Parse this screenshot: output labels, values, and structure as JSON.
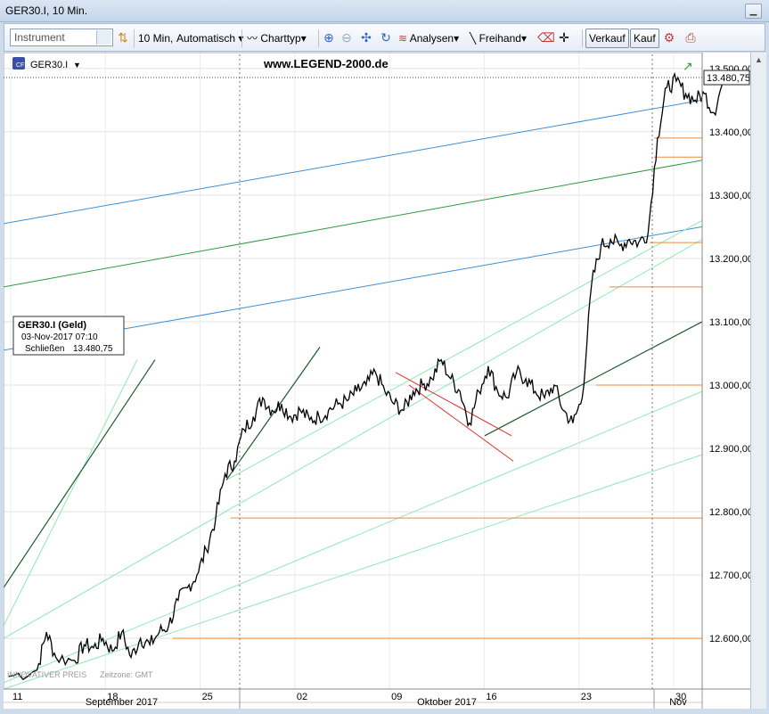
{
  "window": {
    "title": "GER30.I, 10 Min."
  },
  "toolbar": {
    "instrument_placeholder": "Instrument",
    "interval_label": "10 Min,",
    "scale_label": "Automatisch",
    "charttype_label": "Charttyp",
    "analysen_label": "Analysen",
    "freihand_label": "Freihand",
    "sell_label": "Verkauf",
    "buy_label": "Kauf"
  },
  "chart": {
    "symbol_label": "GER30.I",
    "watermark": "www.LEGEND-2000.de",
    "current_price_label": "13.480,75",
    "footer_left": "INNOVATIVER PREIS",
    "footer_tz": "Zeitzone: GMT",
    "infobox": {
      "title": "GER30.I (Geld)",
      "datetime": "03-Nov-2017 07:10",
      "close_label": "Schließen",
      "close_value": "13.480,75"
    },
    "colors": {
      "price": "#000000",
      "blue_line": "#3d8fd0",
      "green_line": "#2e9a3e",
      "light_green": "#8fe8b2",
      "dark_green": "#1d5a2e",
      "red_line": "#e03030",
      "orange_line": "#ef8a3a"
    }
  },
  "chart_data": {
    "type": "line",
    "series_name": "GER30.I",
    "y_ticks": [
      "13.500,00",
      "13.400,00",
      "13.300,00",
      "13.200,00",
      "13.100,00",
      "13.000,00",
      "12.900,00",
      "12.800,00",
      "12.700,00",
      "12.600,00"
    ],
    "y_tick_values": [
      13500,
      13400,
      13300,
      13200,
      13100,
      13000,
      12900,
      12800,
      12700,
      12600
    ],
    "ylim": [
      12520,
      13525
    ],
    "x_day_labels": [
      "11",
      "18",
      "25",
      "02",
      "09",
      "16",
      "23",
      "30"
    ],
    "x_month_labels": [
      "September 2017",
      "Oktober 2017",
      "Nov"
    ],
    "last_value": 13480.75,
    "price_path": [
      [
        0,
        12540
      ],
      [
        3,
        12550
      ],
      [
        4,
        12610
      ],
      [
        5,
        12570
      ],
      [
        7,
        12565
      ],
      [
        8,
        12590
      ],
      [
        9,
        12585
      ],
      [
        10,
        12600
      ],
      [
        11,
        12580
      ],
      [
        12,
        12610
      ],
      [
        13,
        12570
      ],
      [
        14,
        12600
      ],
      [
        15,
        12590
      ],
      [
        16,
        12610
      ],
      [
        17,
        12620
      ],
      [
        18,
        12660
      ],
      [
        19,
        12680
      ],
      [
        20,
        12700
      ],
      [
        21,
        12740
      ],
      [
        22,
        12790
      ],
      [
        23,
        12860
      ],
      [
        24,
        12880
      ],
      [
        25,
        12930
      ],
      [
        26,
        12950
      ],
      [
        27,
        12980
      ],
      [
        28,
        12960
      ],
      [
        29,
        12970
      ],
      [
        30,
        12950
      ],
      [
        31,
        12960
      ],
      [
        32,
        12945
      ],
      [
        33,
        12950
      ],
      [
        34,
        12960
      ],
      [
        35,
        12970
      ],
      [
        36,
        12975
      ],
      [
        37,
        12990
      ],
      [
        38,
        13000
      ],
      [
        39,
        13020
      ],
      [
        40,
        12990
      ],
      [
        41,
        12970
      ],
      [
        42,
        12960
      ],
      [
        43,
        12990
      ],
      [
        44,
        13000
      ],
      [
        45,
        13010
      ],
      [
        46,
        13040
      ],
      [
        47,
        13010
      ],
      [
        48,
        12990
      ],
      [
        49,
        12940
      ],
      [
        50,
        12990
      ],
      [
        51,
        13030
      ],
      [
        52,
        12990
      ],
      [
        53,
        12980
      ],
      [
        54,
        13020
      ],
      [
        55,
        13010
      ],
      [
        56,
        12990
      ],
      [
        57,
        12980
      ],
      [
        58,
        13000
      ],
      [
        59,
        12960
      ],
      [
        60,
        12940
      ],
      [
        61,
        12980
      ],
      [
        62,
        13160
      ],
      [
        63,
        13220
      ],
      [
        64,
        13230
      ],
      [
        65,
        13220
      ],
      [
        66,
        13230
      ],
      [
        67,
        13225
      ],
      [
        68,
        13240
      ],
      [
        69,
        13390
      ],
      [
        70,
        13470
      ],
      [
        71,
        13480
      ],
      [
        72,
        13460
      ],
      [
        73,
        13450
      ],
      [
        74,
        13460
      ],
      [
        75,
        13430
      ],
      [
        76,
        13480
      ]
    ]
  }
}
